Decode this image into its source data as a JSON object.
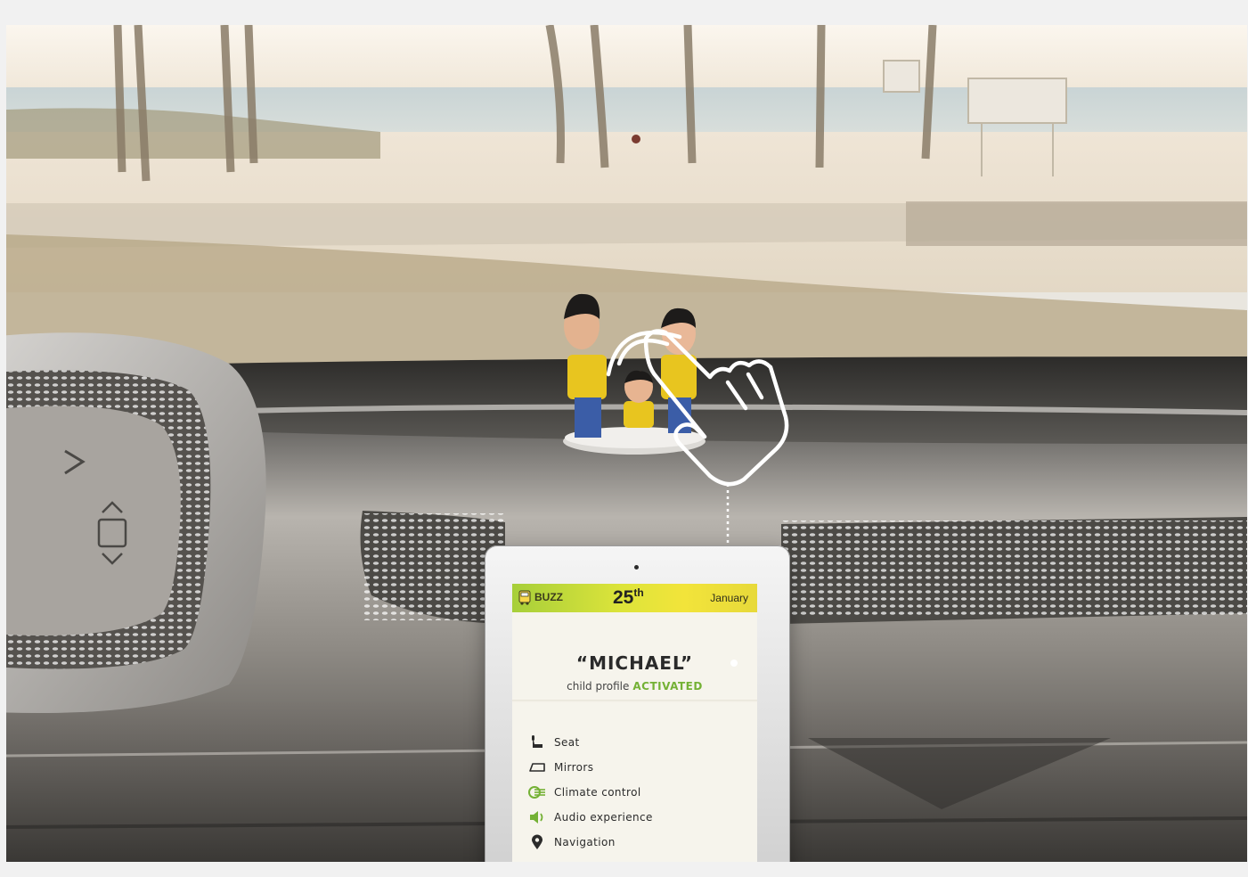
{
  "colors": {
    "accent_green": "#74b135",
    "header_gradient_start": "#a7cf3a",
    "header_gradient_end": "#f2e43a",
    "screen_background": "#f6f4ec"
  },
  "tablet": {
    "header": {
      "brand": "BUZZ",
      "brand_icon": "bus-icon",
      "day": "25",
      "day_suffix": "th",
      "month": "January"
    },
    "profile": {
      "name": "“MICHAEL”",
      "subtitle": "child profile",
      "status": "ACTIVATED"
    },
    "menu": [
      {
        "label": "Seat",
        "icon": "seat-icon"
      },
      {
        "label": "Mirrors",
        "icon": "mirror-icon"
      },
      {
        "label": "Climate control",
        "icon": "climate-icon"
      },
      {
        "label": "Audio experience",
        "icon": "speaker-icon"
      },
      {
        "label": "Navigation",
        "icon": "location-pin-icon"
      }
    ]
  },
  "overlay": {
    "gesture_icon": "hand-tap-icon"
  }
}
